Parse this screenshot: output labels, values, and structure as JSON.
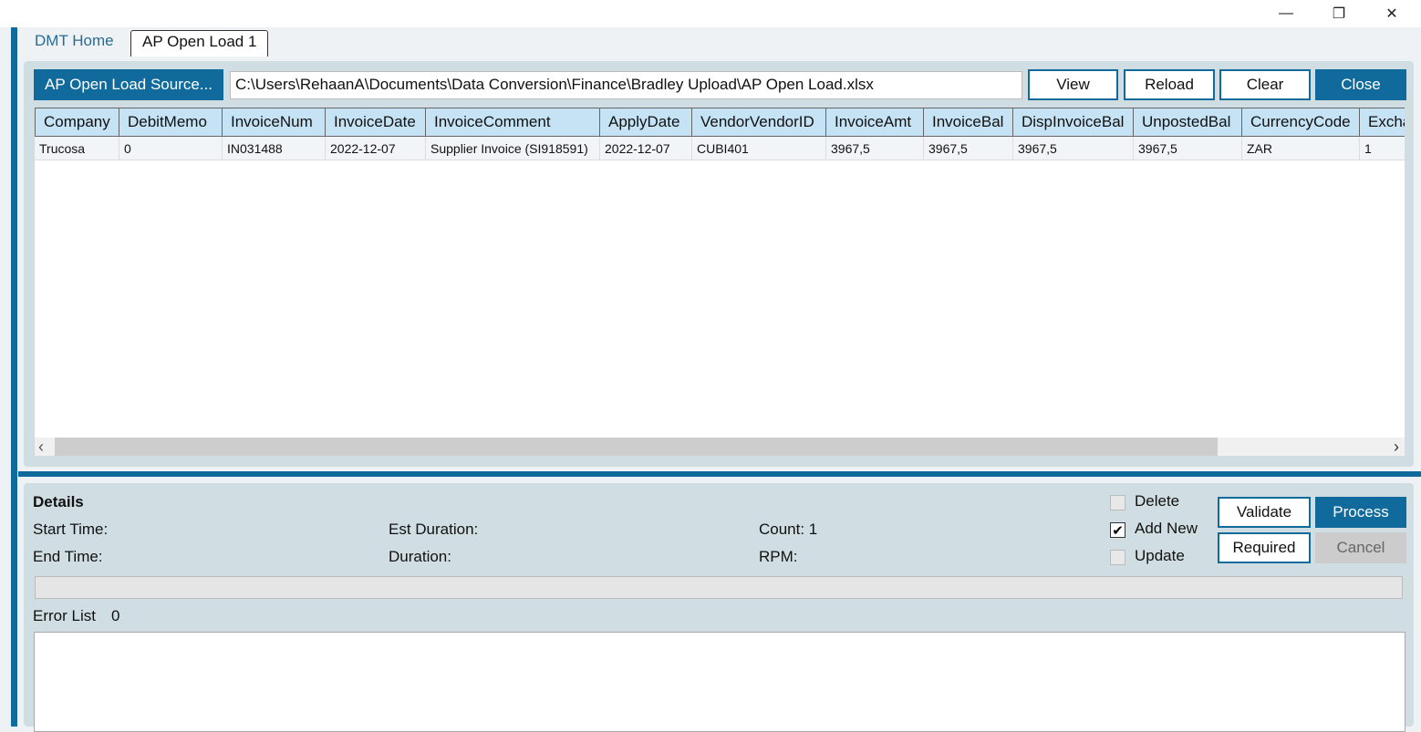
{
  "window": {
    "minimize": "—",
    "restore": "❐",
    "close": "✕"
  },
  "tabs": [
    {
      "label": "DMT Home"
    },
    {
      "label": "AP Open Load 1"
    }
  ],
  "toolbar": {
    "source_button": "AP Open Load Source...",
    "path": "C:\\Users\\RehaanA\\Documents\\Data Conversion\\Finance\\Bradley Upload\\AP Open Load.xlsx",
    "view": "View",
    "reload": "Reload",
    "clear": "Clear",
    "close": "Close"
  },
  "grid": {
    "columns": [
      "Company",
      "DebitMemo",
      "InvoiceNum",
      "InvoiceDate",
      "InvoiceComment",
      "ApplyDate",
      "VendorVendorID",
      "InvoiceAmt",
      "InvoiceBal",
      "DispInvoiceBal",
      "UnpostedBal",
      "CurrencyCode",
      "Excha"
    ],
    "rows": [
      [
        "Trucosa",
        "0",
        "IN031488",
        "2022-12-07",
        "Supplier Invoice (SI918591)",
        "2022-12-07",
        "CUBI401",
        "3967,5",
        "3967,5",
        "3967,5",
        "3967,5",
        "ZAR",
        "1"
      ]
    ],
    "scroll_left": "‹",
    "scroll_right": "›"
  },
  "details": {
    "title": "Details",
    "start_time": "Start Time:",
    "end_time": "End Time:",
    "est_duration": "Est Duration:",
    "duration": "Duration:",
    "count": "Count: 1",
    "rpm": "RPM:",
    "options": [
      {
        "label": "Delete",
        "checked": false
      },
      {
        "label": "Add New",
        "checked": true
      },
      {
        "label": "Update",
        "checked": false
      }
    ],
    "validate": "Validate",
    "process": "Process",
    "required": "Required",
    "cancel": "Cancel",
    "error_list_label": "Error List",
    "error_count": "0",
    "check_mark": "✔"
  }
}
